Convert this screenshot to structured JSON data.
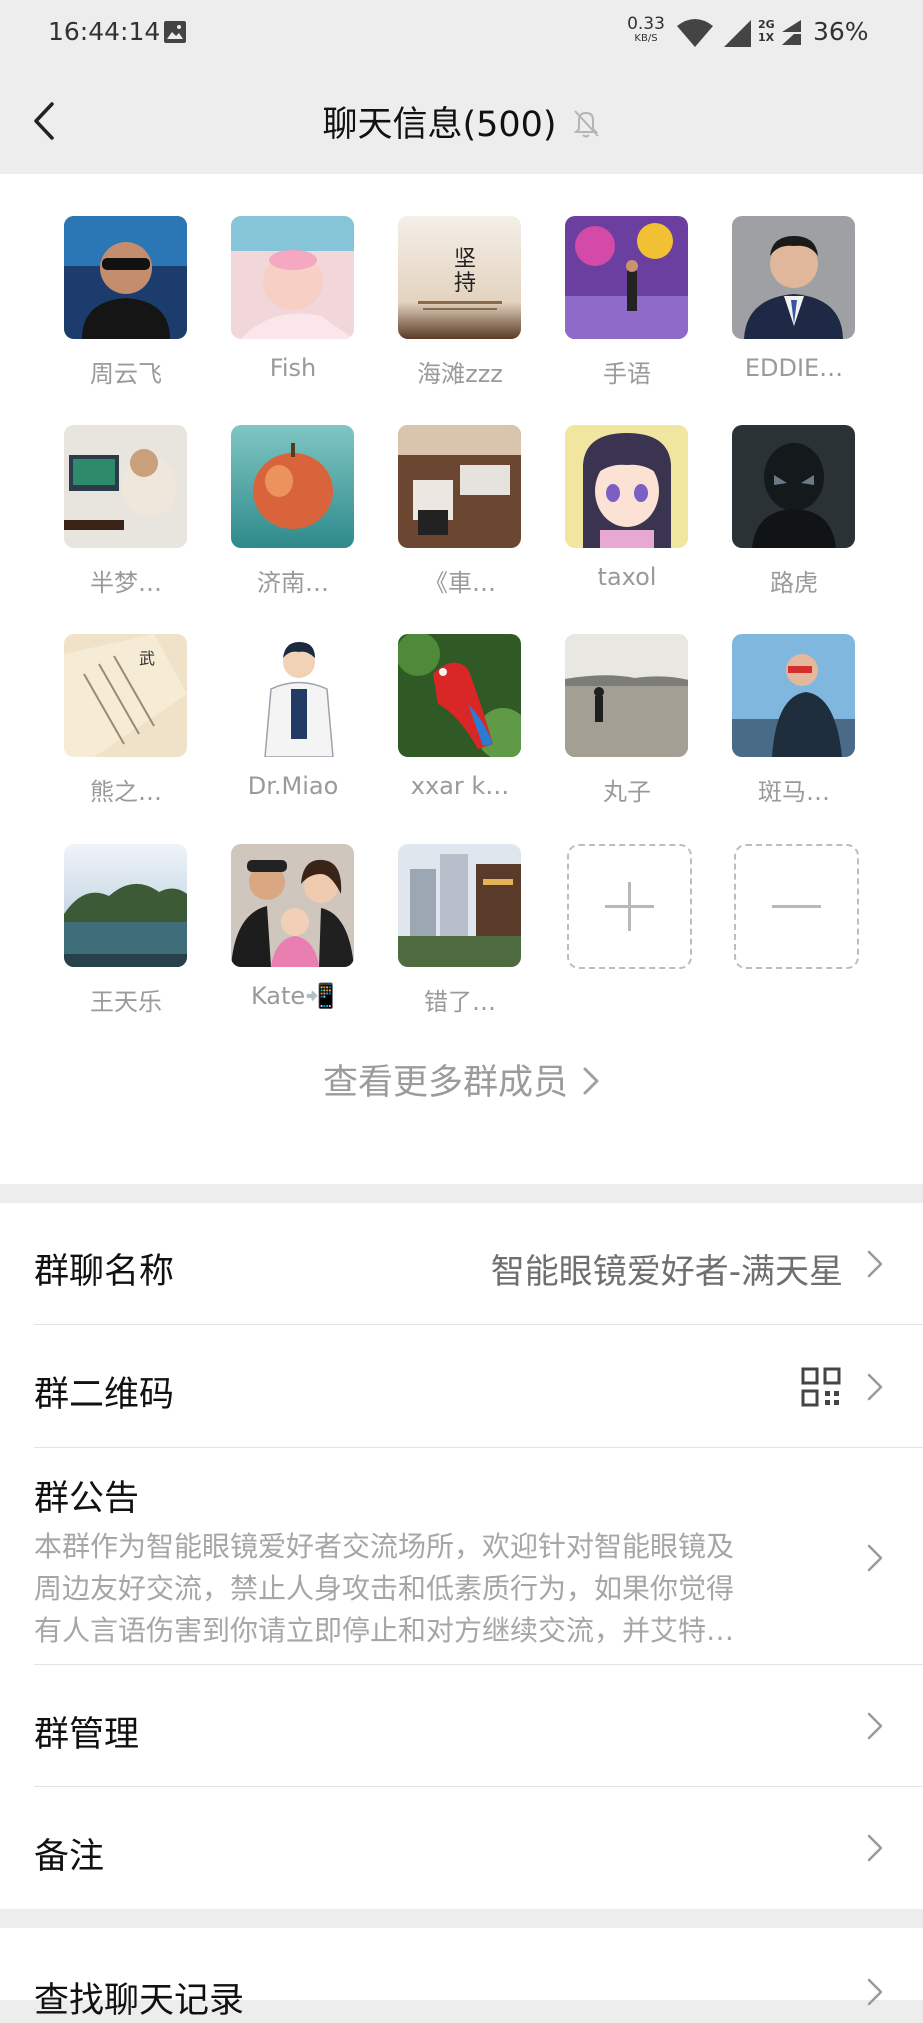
{
  "status_bar": {
    "time": "16:44:14",
    "net_speed": "0.33",
    "net_speed_unit": "KB/S",
    "network_type_top": "2G",
    "network_type_bottom": "1X",
    "battery": "36%"
  },
  "nav": {
    "title": "聊天信息(500)"
  },
  "members": [
    {
      "name": "周云飞"
    },
    {
      "name": "Fish"
    },
    {
      "name": "海滩zzz"
    },
    {
      "name": "手语"
    },
    {
      "name": "EDDIE…"
    },
    {
      "name": "半梦…"
    },
    {
      "name": "济南…"
    },
    {
      "name": "《車…"
    },
    {
      "name": "taxol"
    },
    {
      "name": "路虎"
    },
    {
      "name": "熊之…"
    },
    {
      "name": "Dr.Miao"
    },
    {
      "name": "xxar k…"
    },
    {
      "name": "丸子"
    },
    {
      "name": "斑马…"
    },
    {
      "name": "王天乐"
    },
    {
      "name": "Kate📲"
    },
    {
      "name": "错了…"
    }
  ],
  "view_more": "查看更多群成员",
  "settings": {
    "group_name": {
      "label": "群聊名称",
      "value": "智能眼镜爱好者-满天星"
    },
    "qr_code": {
      "label": "群二维码"
    },
    "notice": {
      "label": "群公告",
      "lines": [
        "本群作为智能眼镜爱好者交流场所，欢迎针对智能眼镜及",
        "周边友好交流，禁止人身攻击和低素质行为，如果你觉得",
        "有人言语伤害到你请立即停止和对方继续交流，并艾特…"
      ]
    },
    "manage": {
      "label": "群管理"
    },
    "remark": {
      "label": "备注"
    },
    "search_history": {
      "label": "查找聊天记录"
    }
  },
  "colors": {
    "background": "#ededed",
    "card": "#ffffff",
    "secondary_text": "#9a9a9a"
  }
}
